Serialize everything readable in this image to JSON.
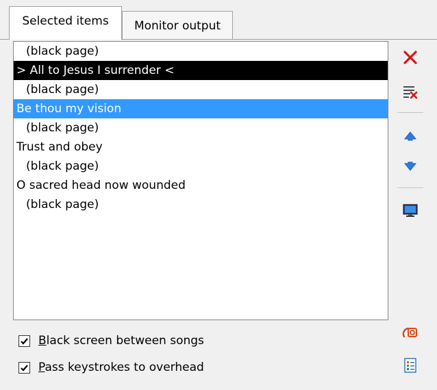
{
  "tabs": [
    {
      "label": "Selected items"
    },
    {
      "label": "Monitor output"
    }
  ],
  "items": [
    {
      "label": "(black page)",
      "indent": true,
      "state": "normal"
    },
    {
      "label": "> All to Jesus I surrender <",
      "indent": false,
      "state": "live"
    },
    {
      "label": "(black page)",
      "indent": true,
      "state": "normal"
    },
    {
      "label": "Be thou my vision",
      "indent": false,
      "state": "selected"
    },
    {
      "label": "(black page)",
      "indent": true,
      "state": "normal"
    },
    {
      "label": "Trust and obey",
      "indent": false,
      "state": "normal"
    },
    {
      "label": "(black page)",
      "indent": true,
      "state": "normal"
    },
    {
      "label": "O sacred head now wounded",
      "indent": false,
      "state": "normal"
    },
    {
      "label": "(black page)",
      "indent": true,
      "state": "normal"
    }
  ],
  "toolbar_icons": [
    "delete-icon",
    "clear-list-icon",
    "move-up-icon",
    "move-down-icon",
    "monitor-icon",
    "presentation-icon",
    "list-properties-icon"
  ],
  "options": {
    "black_screen": {
      "checked": true,
      "accel": "B",
      "rest": "lack screen between songs"
    },
    "pass_keys": {
      "checked": true,
      "accel": "P",
      "rest": "ass keystrokes to overhead"
    }
  },
  "colors": {
    "selection": "#3399ff",
    "live": "#000000",
    "delete_red": "#d01818",
    "arrow_blue": "#2f7be0"
  }
}
